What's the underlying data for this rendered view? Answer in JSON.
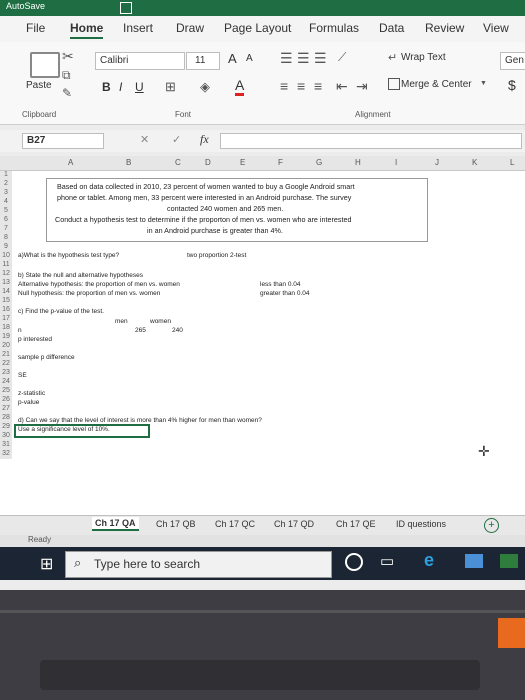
{
  "title_bar": {
    "text": "AutoSave"
  },
  "menu": {
    "file": "File",
    "home": "Home",
    "insert": "Insert",
    "draw": "Draw",
    "page_layout": "Page Layout",
    "formulas": "Formulas",
    "data": "Data",
    "review": "Review",
    "view": "View"
  },
  "ribbon": {
    "paste": "Paste",
    "font_name": "Calibri",
    "font_size": "11",
    "font_grow": "A",
    "font_shrink": "A",
    "bold": "B",
    "italic": "I",
    "underline": "U",
    "font_color": "A",
    "wrap_text": "Wrap Text",
    "merge_center": "Merge & Center",
    "number_format": "Gen",
    "currency": "$",
    "clipboard_label": "Clipboard",
    "font_label": "Font",
    "alignment_label": "Alignment"
  },
  "formula_bar": {
    "name_box": "B27",
    "fx": "fx",
    "cancel": "✕",
    "enter": "✓"
  },
  "columns": [
    "A",
    "B",
    "C",
    "D",
    "E",
    "F",
    "G",
    "H",
    "I",
    "J",
    "K",
    "L"
  ],
  "rows": [
    "1",
    "2",
    "3",
    "4",
    "5",
    "6",
    "7",
    "8",
    "9",
    "10",
    "11",
    "12",
    "13",
    "14",
    "15",
    "16",
    "17",
    "18",
    "19",
    "20",
    "21",
    "22",
    "23",
    "24",
    "25",
    "26",
    "27",
    "28",
    "29",
    "30",
    "31",
    "32"
  ],
  "cells": {
    "problem_l1": "Based on data collected in 2010, 23 percent of women wanted to buy a Google Android smart",
    "problem_l2": "phone or tablet.  Among men, 33 percent were interested in an Android purchase.  The survey",
    "problem_l3": "contacted 240 women and 265 men.",
    "problem_l4": "Conduct a hypothesis test to determine if the proporton of men vs. women who are interested",
    "problem_l5": "in an Android purchase is greater than 4%.",
    "q_a": "a)What is the hypothesis test type?",
    "q_a_ans": "two proportion 2-test",
    "q_b": "b) State the null and alternative hypotheses",
    "alt_hyp": "Alternative hypothesis: the proportion of men vs. women",
    "alt_hyp_val": "less than 0.04",
    "null_hyp": "Null hypothesis: the proportion of men vs. women",
    "null_hyp_val": "greater than 0.04",
    "q_c": "c) Find the p-value of the test.",
    "hdr_men": "men",
    "hdr_women": "women",
    "lbl_n": "n",
    "n_men": "265",
    "n_women": "240",
    "lbl_p": "p interested",
    "lbl_sample_diff": "sample p difference",
    "lbl_se": "SE",
    "lbl_zstat": "z-statistic",
    "lbl_pvalue": "p-value",
    "q_d": "d) Can we say that the level of interest is more than 4% higher for men than women?",
    "q_d2": "Use a significance level of 10%."
  },
  "sheet_tabs": [
    "Ch 17 QA",
    "Ch 17 QB",
    "Ch 17 QC",
    "Ch 17 QD",
    "Ch 17 QE",
    "ID questions"
  ],
  "status": {
    "ready": "Ready"
  },
  "taskbar": {
    "search_placeholder": "Type here to search"
  }
}
